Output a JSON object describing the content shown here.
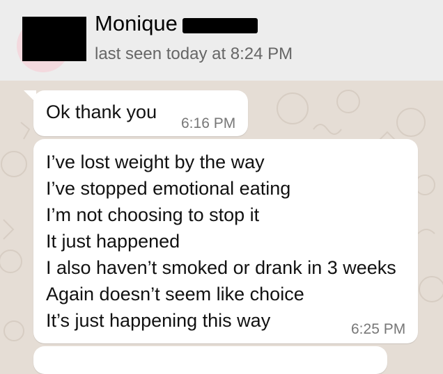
{
  "header": {
    "contact_name": "Monique",
    "last_seen": "last seen today at 8:24 PM"
  },
  "messages": [
    {
      "lines": [
        "Ok thank you"
      ],
      "time": "6:16 PM"
    },
    {
      "lines": [
        "I’ve lost weight by the way",
        "I’ve stopped emotional eating",
        "I’m not choosing to stop it",
        "It just happened",
        "I also haven’t smoked or drank in 3 weeks",
        "Again doesn’t seem like choice",
        "It’s just happening this way"
      ],
      "time": "6:25 PM"
    }
  ],
  "colors": {
    "header_bg": "#ededed",
    "chat_bg": "#e5ddd5",
    "bubble_bg": "#ffffff",
    "timestamp": "#777777"
  }
}
